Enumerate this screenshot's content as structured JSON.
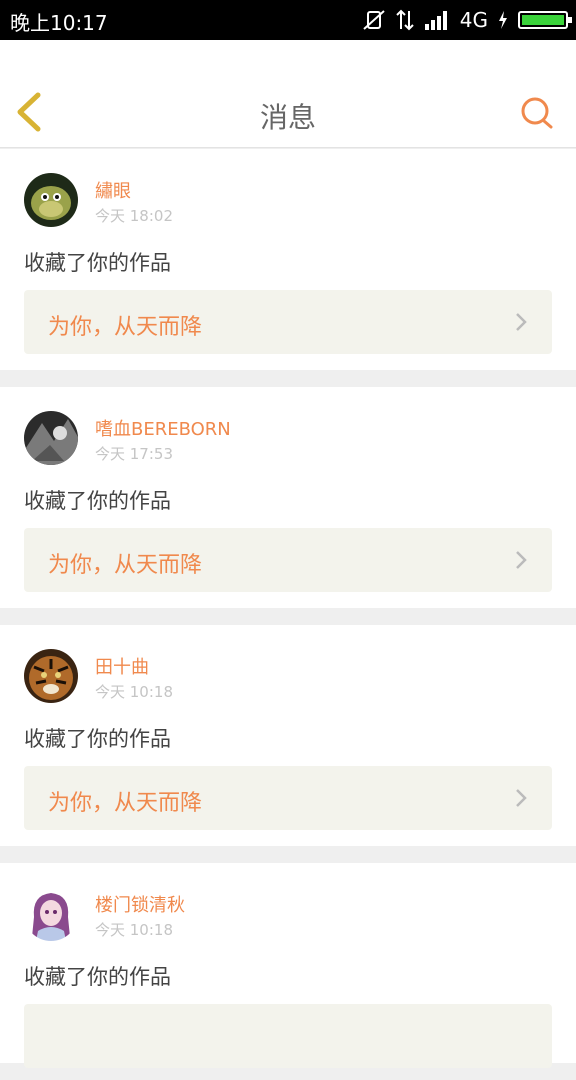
{
  "status_bar": {
    "time": "晚上10:17",
    "network": "4G"
  },
  "header": {
    "title": "消息",
    "back_icon": "back-chevron-icon",
    "search_icon": "search-icon"
  },
  "accent_color": "#f0894d",
  "messages": [
    {
      "user": "繡眼",
      "time": "今天 18:02",
      "action": "收藏了你的作品",
      "work_title": "为你，从天而降"
    },
    {
      "user": "嗜血BEREBORN",
      "time": "今天 17:53",
      "action": "收藏了你的作品",
      "work_title": "为你，从天而降"
    },
    {
      "user": "田十曲",
      "time": "今天 10:18",
      "action": "收藏了你的作品",
      "work_title": "为你，从天而降"
    },
    {
      "user": "楼门锁清秋",
      "time": "今天 10:18",
      "action": "收藏了你的作品",
      "work_title": ""
    }
  ]
}
